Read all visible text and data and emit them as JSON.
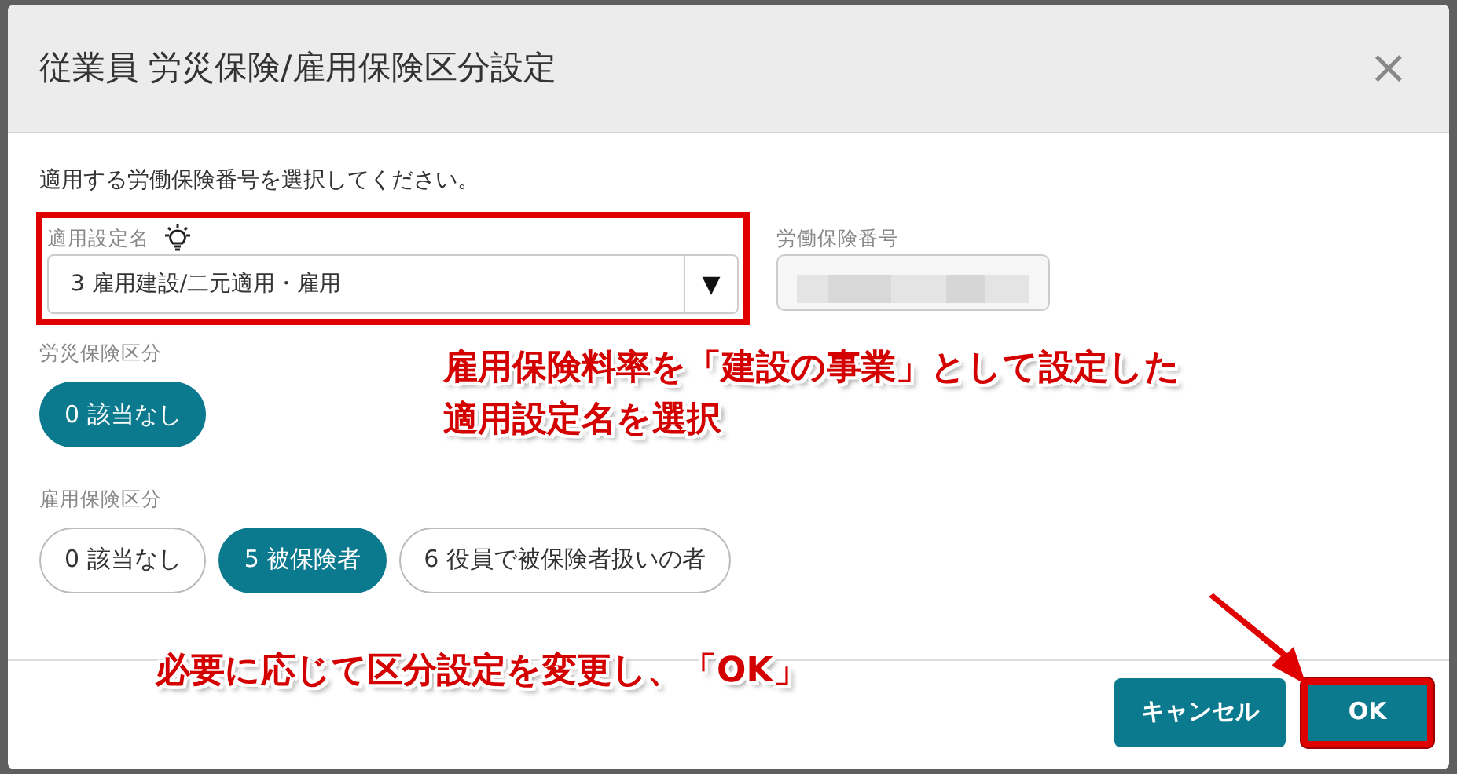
{
  "dialog": {
    "title": "従業員 労災保険/雇用保険区分設定",
    "close": "×"
  },
  "instruction": "適用する労働保険番号を選択してください。",
  "setting_field": {
    "label": "適用設定名",
    "value": "3 雇用建設/二元適用・雇用",
    "caret": "▼",
    "highlighted": true
  },
  "number_field": {
    "label": "労働保険番号"
  },
  "groups": [
    {
      "label": "労災保険区分",
      "options": [
        {
          "label": "0 該当なし",
          "selected": true
        }
      ]
    },
    {
      "label": "雇用保険区分",
      "options": [
        {
          "label": "0 該当なし",
          "selected": false
        },
        {
          "label": "5 被保険者",
          "selected": true
        },
        {
          "label": "6 役員で被保険者扱いの者",
          "selected": false
        }
      ]
    }
  ],
  "buttons": [
    {
      "label": "キャンセル",
      "highlighted": false
    },
    {
      "label": "OK",
      "highlighted": true
    }
  ],
  "annotations": [
    {
      "lines": [
        "雇用保険料率を「建設の事業」として設定した",
        "適用設定名を選択"
      ]
    },
    {
      "lines": [
        "必要に応じて区分設定を変更し、「**OK**」"
      ]
    }
  ]
}
